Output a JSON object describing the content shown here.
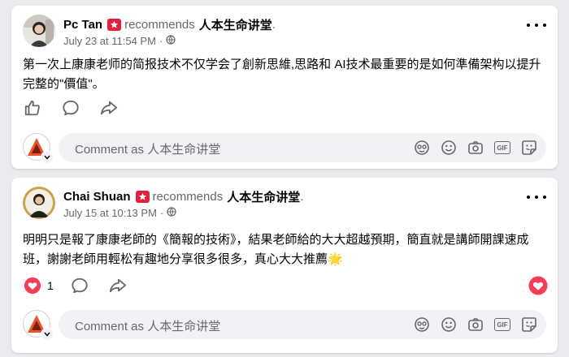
{
  "posts": [
    {
      "author": "Pc Tan",
      "recommends_text": "recommends",
      "page_name": "人本生命讲堂",
      "date": "July 23 at 11:54 PM",
      "separator": "·",
      "text": "第一次上康康老师的简报技术不仅学会了創新思維,思路和 AI技术最重要的是如何準備架构以提升完整的\"價值\"。",
      "like_count": "",
      "comment_placeholder": "Comment as 人本生命讲堂"
    },
    {
      "author": "Chai Shuan",
      "recommends_text": "recommends",
      "page_name": "人本生命讲堂",
      "date": "July 15 at 10:13 PM",
      "separator": "·",
      "text": "明明只是報了康康老師的《簡報的技術》，結果老師給的大大超越預期，簡直就是講師開課速成班，謝謝老師用輕松有趣地分享很多很多，真心大大推薦🌟",
      "like_count": "1",
      "comment_placeholder": "Comment as 人本生命讲堂"
    }
  ],
  "colors": {
    "badge": "#e41e3f",
    "muted": "#65676b",
    "comment_bg": "#f0f2f5",
    "like_heart": "#e41e3f"
  },
  "icons": [
    "recommend-badge-icon",
    "globe-icon",
    "more-icon",
    "like-icon",
    "comment-icon",
    "share-icon",
    "heart-icon",
    "avatar-sticker-icon",
    "emoji-icon",
    "camera-icon",
    "gif-icon",
    "sticker-icon",
    "chevron-down-icon"
  ]
}
